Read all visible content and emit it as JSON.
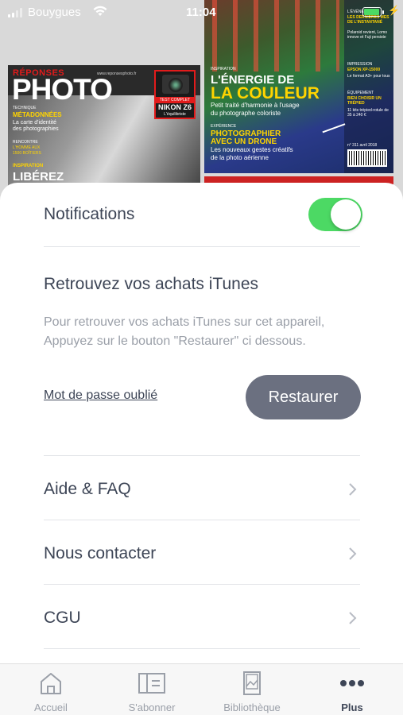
{
  "status_bar": {
    "carrier": "Bouygues",
    "time": "11:04",
    "battery_level": 0.95
  },
  "covers": {
    "left": {
      "masthead_top": "RÉPONSES",
      "masthead": "PHOTO",
      "url": "www.reponsesphoto.fr",
      "test_tag": "TEST COMPLET",
      "test_name": "NIKON Z6",
      "test_sub": "L'équilibriste",
      "technique_label": "TECHNIQUE",
      "technique_title": "MÉTADONNÉES",
      "technique_sub1": "La carte d'identité",
      "technique_sub2": "des photographies",
      "rencontre_label": "RENCONTRE",
      "rencontre_text1": "L'HOMME AUX",
      "rencontre_text2": "1500 BOÎTIERS",
      "inspiration_label": "INSPIRATION",
      "big_text": "LIBÉREZ"
    },
    "right": {
      "inspiration_label": "INSPIRATION",
      "headline_1": "L'ÉNERGIE DE",
      "headline_2": "LA COULEUR",
      "sub_1": "Petit traité d'harmonie à l'usage",
      "sub_2": "du photographe coloriste",
      "experience_label": "EXPÉRIENCE",
      "headline_3": "PHOTOGRAPHIER",
      "headline_4": "AVEC UN DRONE",
      "sub_3": "Les nouveaux gestes créatifs",
      "sub_4": "de la photo aérienne",
      "side_1": "L'ÉVÉNEMENT",
      "side_2": "LES DERNIÈRES MES DE L'INSTANTANÉ",
      "side_3": "Polaroid revient, Lomo innove et Fuji persiste",
      "side_4": "IMPRESSION",
      "side_5": "EPSON XP-15000",
      "side_6": "Le format A3+ pour tous",
      "side_7": "ÉQUIPEMENT",
      "side_8": "BIEN CHOISIR UN TRÉPIED",
      "side_9": "11 kits trépied-rotule de 35 à 240 €",
      "side_10": "n° 311 avril 2018"
    }
  },
  "settings": {
    "notifications_label": "Notifications",
    "notifications_enabled": true,
    "itunes_title": "Retrouvez vos achats iTunes",
    "itunes_description": "Pour retrouver vos achats iTunes sur cet appareil, Appuyez sur le bouton \"Restaurer\" ci dessous.",
    "forgot_password": "Mot de passe oublié",
    "restore_button": "Restaurer",
    "nav_items": [
      {
        "label": "Aide & FAQ"
      },
      {
        "label": "Nous contacter"
      },
      {
        "label": "CGU"
      }
    ]
  },
  "tab_bar": {
    "items": [
      {
        "label": "Accueil",
        "icon": "home-icon",
        "active": false
      },
      {
        "label": "S'abonner",
        "icon": "subscribe-card-icon",
        "active": false
      },
      {
        "label": "Bibliothèque",
        "icon": "library-icon",
        "active": false
      },
      {
        "label": "Plus",
        "icon": "more-dots-icon",
        "active": true
      }
    ]
  },
  "colors": {
    "toggle_on": "#4cd964",
    "text_primary": "#3d4556",
    "text_secondary": "#9a9fa8",
    "restore_button_bg": "#6b7080"
  }
}
